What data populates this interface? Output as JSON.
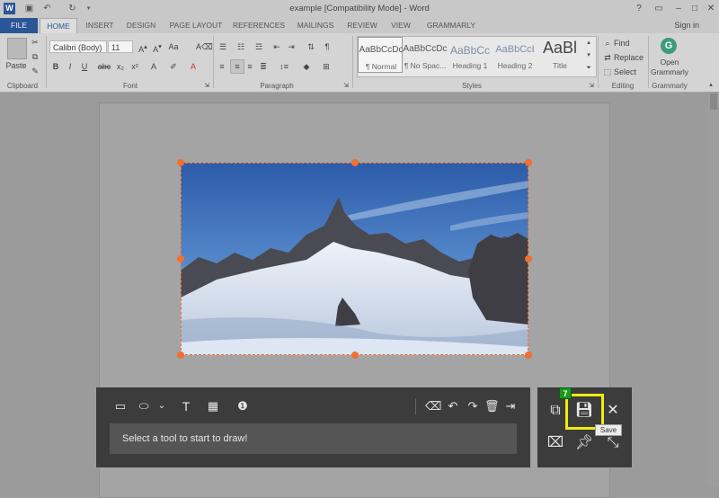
{
  "window": {
    "title": "example [Compatibility Mode] - Word",
    "minimize": "–",
    "maximize": "□",
    "close": "✕",
    "help": "?"
  },
  "tabs": {
    "file": "FILE",
    "items": [
      "HOME",
      "INSERT",
      "DESIGN",
      "PAGE LAYOUT",
      "REFERENCES",
      "MAILINGS",
      "REVIEW",
      "VIEW",
      "GRAMMARLY"
    ],
    "sign_in": "Sign in"
  },
  "ribbon": {
    "clipboard": {
      "paste": "Paste",
      "label": "Clipboard"
    },
    "font": {
      "name": "Calibri (Body)",
      "size": "11",
      "label": "Font"
    },
    "paragraph": {
      "label": "Paragraph"
    },
    "styles": {
      "label": "Styles",
      "items": [
        {
          "sample": "AaBbCcDc",
          "name": "¶ Normal"
        },
        {
          "sample": "AaBbCcDc",
          "name": "¶ No Spac..."
        },
        {
          "sample": "AaBbCc",
          "name": "Heading 1"
        },
        {
          "sample": "AaBbCcI",
          "name": "Heading 2"
        },
        {
          "sample": "AaBl",
          "name": "Title"
        }
      ]
    },
    "editing": {
      "find": "Find",
      "replace": "Replace",
      "select": "Select",
      "label": "Editing"
    },
    "grammarly": {
      "open_line1": "Open",
      "open_line2": "Grammarly",
      "label": "Grammarly"
    }
  },
  "draw_panel": {
    "hint": "Select a tool to start to draw!"
  },
  "action_panel": {
    "badge": "7",
    "save_tooltip": "Save"
  },
  "colors": {
    "file_tab": "#2a5696",
    "selection": "#f07030",
    "highlight": "#f0ec10",
    "badge": "#1a9a1a"
  }
}
